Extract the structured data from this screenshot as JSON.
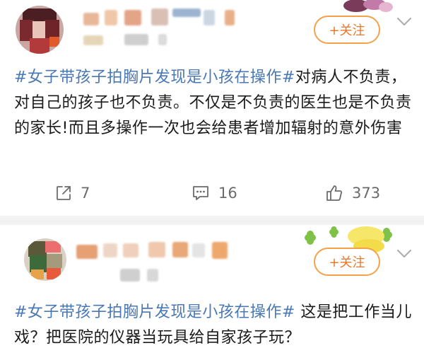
{
  "posts": [
    {
      "follow_label": "+关注",
      "text_topic": "#女子带孩子拍胸片发现是小孩在操作#",
      "text_body": "对病人不负责，对自己的孩子也不负责。不仅是不负责的医生也是不负责的家长!而且多操作一次也会给患者增加辐射的意外伤害",
      "actions": {
        "repost_count": "7",
        "comment_count": "16",
        "like_count": "373"
      }
    },
    {
      "follow_label": "+关注",
      "text_topic": "#女子带孩子拍胸片发现是小孩在操作#",
      "text_body": " 这是把工作当儿戏？把医院的仪器当玩具给自家孩子玩？"
    }
  ],
  "colors": {
    "topic": "#4a78b4",
    "follow_border": "#f5a14a",
    "follow_text": "#e8782c",
    "action_gray": "#6b6b6b"
  },
  "icons": [
    "repost-icon",
    "comment-icon",
    "like-icon",
    "chevron-down-icon"
  ]
}
